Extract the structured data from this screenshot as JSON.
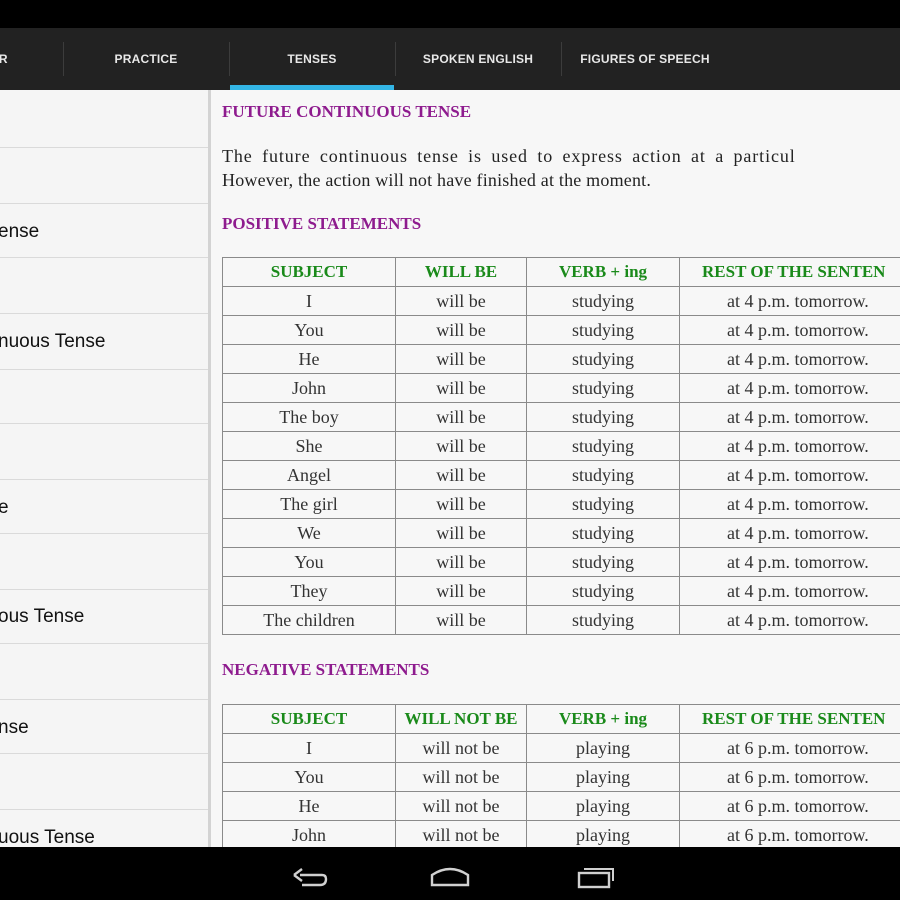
{
  "tabs": [
    {
      "label": "AR"
    },
    {
      "label": "PRACTICE"
    },
    {
      "label": "TENSES",
      "selected": true
    },
    {
      "label": "SPOKEN ENGLISH"
    },
    {
      "label": "FIGURES OF SPEECH"
    }
  ],
  "sidebar": {
    "items": [
      {
        "label": ""
      },
      {
        "label": ""
      },
      {
        "label": "ense"
      },
      {
        "label": "ı"
      },
      {
        "label": "nuous Tense"
      },
      {
        "label": ""
      },
      {
        "label": ""
      },
      {
        "label": "e"
      },
      {
        "label": ""
      },
      {
        "label": "ous Tense"
      },
      {
        "label": ""
      },
      {
        "label": "nse"
      },
      {
        "label": ""
      },
      {
        "label": "uous Tense"
      }
    ]
  },
  "article": {
    "title": "FUTURE CONTINUOUS TENSE",
    "paragraph_line1": "The future continuous tense is used to express action at a particul",
    "paragraph_line2": "However, the action will not have finished at the moment.",
    "positive": {
      "heading": "POSITIVE STATEMENTS",
      "headers": [
        "SUBJECT",
        "WILL BE",
        "VERB + ing",
        "REST OF THE SENTEN"
      ],
      "rows": [
        [
          "I",
          "will be",
          "studying",
          "at 4 p.m. tomorrow."
        ],
        [
          "You",
          "will be",
          "studying",
          "at 4 p.m. tomorrow."
        ],
        [
          "He",
          "will be",
          "studying",
          "at 4 p.m. tomorrow."
        ],
        [
          "John",
          "will be",
          "studying",
          "at 4 p.m. tomorrow."
        ],
        [
          "The boy",
          "will be",
          "studying",
          "at 4 p.m. tomorrow."
        ],
        [
          "She",
          "will be",
          "studying",
          "at 4 p.m. tomorrow."
        ],
        [
          "Angel",
          "will be",
          "studying",
          "at 4 p.m. tomorrow."
        ],
        [
          "The girl",
          "will be",
          "studying",
          "at 4 p.m. tomorrow."
        ],
        [
          "We",
          "will be",
          "studying",
          "at 4 p.m. tomorrow."
        ],
        [
          "You",
          "will be",
          "studying",
          "at 4 p.m. tomorrow."
        ],
        [
          "They",
          "will be",
          "studying",
          "at 4 p.m. tomorrow."
        ],
        [
          "The children",
          "will be",
          "studying",
          "at 4 p.m. tomorrow."
        ]
      ]
    },
    "negative": {
      "heading": "NEGATIVE STATEMENTS",
      "headers": [
        "SUBJECT",
        "WILL NOT BE",
        "VERB + ing",
        "REST OF THE SENTEN"
      ],
      "rows": [
        [
          "I",
          "will not be",
          "playing",
          "at 6 p.m. tomorrow."
        ],
        [
          "You",
          "will not be",
          "playing",
          "at 6 p.m. tomorrow."
        ],
        [
          "He",
          "will not be",
          "playing",
          "at 6 p.m. tomorrow."
        ],
        [
          "John",
          "will not be",
          "playing",
          "at 6 p.m. tomorrow."
        ]
      ]
    }
  },
  "colors": {
    "tab_indicator": "#33b5e5",
    "heading": "#8e1b8e",
    "table_header": "#1a8a1a"
  },
  "navbar": {
    "icons": [
      "back-icon",
      "home-icon",
      "recent-apps-icon"
    ]
  }
}
